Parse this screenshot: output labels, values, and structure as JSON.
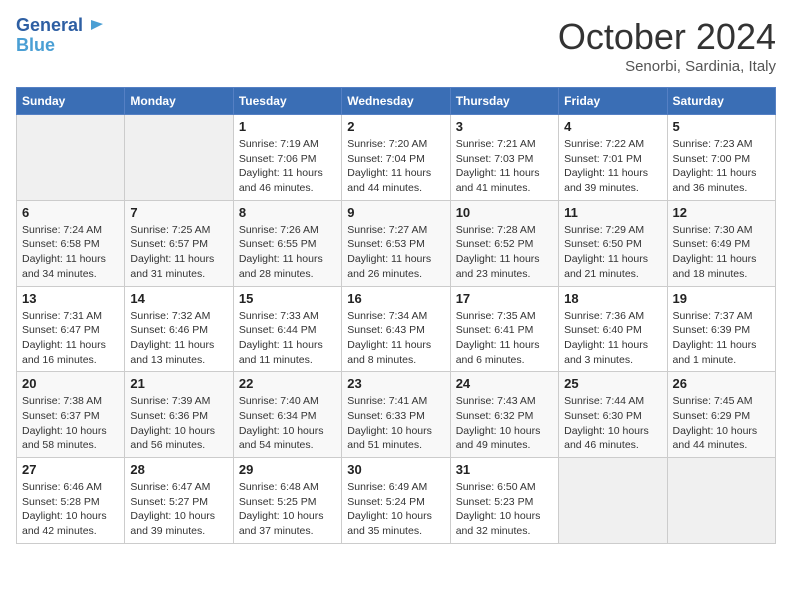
{
  "header": {
    "logo_line1": "General",
    "logo_line2": "Blue",
    "title": "October 2024",
    "location": "Senorbi, Sardinia, Italy"
  },
  "weekdays": [
    "Sunday",
    "Monday",
    "Tuesday",
    "Wednesday",
    "Thursday",
    "Friday",
    "Saturday"
  ],
  "weeks": [
    [
      {
        "day": null
      },
      {
        "day": null
      },
      {
        "day": "1",
        "sunrise": "Sunrise: 7:19 AM",
        "sunset": "Sunset: 7:06 PM",
        "daylight": "Daylight: 11 hours and 46 minutes."
      },
      {
        "day": "2",
        "sunrise": "Sunrise: 7:20 AM",
        "sunset": "Sunset: 7:04 PM",
        "daylight": "Daylight: 11 hours and 44 minutes."
      },
      {
        "day": "3",
        "sunrise": "Sunrise: 7:21 AM",
        "sunset": "Sunset: 7:03 PM",
        "daylight": "Daylight: 11 hours and 41 minutes."
      },
      {
        "day": "4",
        "sunrise": "Sunrise: 7:22 AM",
        "sunset": "Sunset: 7:01 PM",
        "daylight": "Daylight: 11 hours and 39 minutes."
      },
      {
        "day": "5",
        "sunrise": "Sunrise: 7:23 AM",
        "sunset": "Sunset: 7:00 PM",
        "daylight": "Daylight: 11 hours and 36 minutes."
      }
    ],
    [
      {
        "day": "6",
        "sunrise": "Sunrise: 7:24 AM",
        "sunset": "Sunset: 6:58 PM",
        "daylight": "Daylight: 11 hours and 34 minutes."
      },
      {
        "day": "7",
        "sunrise": "Sunrise: 7:25 AM",
        "sunset": "Sunset: 6:57 PM",
        "daylight": "Daylight: 11 hours and 31 minutes."
      },
      {
        "day": "8",
        "sunrise": "Sunrise: 7:26 AM",
        "sunset": "Sunset: 6:55 PM",
        "daylight": "Daylight: 11 hours and 28 minutes."
      },
      {
        "day": "9",
        "sunrise": "Sunrise: 7:27 AM",
        "sunset": "Sunset: 6:53 PM",
        "daylight": "Daylight: 11 hours and 26 minutes."
      },
      {
        "day": "10",
        "sunrise": "Sunrise: 7:28 AM",
        "sunset": "Sunset: 6:52 PM",
        "daylight": "Daylight: 11 hours and 23 minutes."
      },
      {
        "day": "11",
        "sunrise": "Sunrise: 7:29 AM",
        "sunset": "Sunset: 6:50 PM",
        "daylight": "Daylight: 11 hours and 21 minutes."
      },
      {
        "day": "12",
        "sunrise": "Sunrise: 7:30 AM",
        "sunset": "Sunset: 6:49 PM",
        "daylight": "Daylight: 11 hours and 18 minutes."
      }
    ],
    [
      {
        "day": "13",
        "sunrise": "Sunrise: 7:31 AM",
        "sunset": "Sunset: 6:47 PM",
        "daylight": "Daylight: 11 hours and 16 minutes."
      },
      {
        "day": "14",
        "sunrise": "Sunrise: 7:32 AM",
        "sunset": "Sunset: 6:46 PM",
        "daylight": "Daylight: 11 hours and 13 minutes."
      },
      {
        "day": "15",
        "sunrise": "Sunrise: 7:33 AM",
        "sunset": "Sunset: 6:44 PM",
        "daylight": "Daylight: 11 hours and 11 minutes."
      },
      {
        "day": "16",
        "sunrise": "Sunrise: 7:34 AM",
        "sunset": "Sunset: 6:43 PM",
        "daylight": "Daylight: 11 hours and 8 minutes."
      },
      {
        "day": "17",
        "sunrise": "Sunrise: 7:35 AM",
        "sunset": "Sunset: 6:41 PM",
        "daylight": "Daylight: 11 hours and 6 minutes."
      },
      {
        "day": "18",
        "sunrise": "Sunrise: 7:36 AM",
        "sunset": "Sunset: 6:40 PM",
        "daylight": "Daylight: 11 hours and 3 minutes."
      },
      {
        "day": "19",
        "sunrise": "Sunrise: 7:37 AM",
        "sunset": "Sunset: 6:39 PM",
        "daylight": "Daylight: 11 hours and 1 minute."
      }
    ],
    [
      {
        "day": "20",
        "sunrise": "Sunrise: 7:38 AM",
        "sunset": "Sunset: 6:37 PM",
        "daylight": "Daylight: 10 hours and 58 minutes."
      },
      {
        "day": "21",
        "sunrise": "Sunrise: 7:39 AM",
        "sunset": "Sunset: 6:36 PM",
        "daylight": "Daylight: 10 hours and 56 minutes."
      },
      {
        "day": "22",
        "sunrise": "Sunrise: 7:40 AM",
        "sunset": "Sunset: 6:34 PM",
        "daylight": "Daylight: 10 hours and 54 minutes."
      },
      {
        "day": "23",
        "sunrise": "Sunrise: 7:41 AM",
        "sunset": "Sunset: 6:33 PM",
        "daylight": "Daylight: 10 hours and 51 minutes."
      },
      {
        "day": "24",
        "sunrise": "Sunrise: 7:43 AM",
        "sunset": "Sunset: 6:32 PM",
        "daylight": "Daylight: 10 hours and 49 minutes."
      },
      {
        "day": "25",
        "sunrise": "Sunrise: 7:44 AM",
        "sunset": "Sunset: 6:30 PM",
        "daylight": "Daylight: 10 hours and 46 minutes."
      },
      {
        "day": "26",
        "sunrise": "Sunrise: 7:45 AM",
        "sunset": "Sunset: 6:29 PM",
        "daylight": "Daylight: 10 hours and 44 minutes."
      }
    ],
    [
      {
        "day": "27",
        "sunrise": "Sunrise: 6:46 AM",
        "sunset": "Sunset: 5:28 PM",
        "daylight": "Daylight: 10 hours and 42 minutes."
      },
      {
        "day": "28",
        "sunrise": "Sunrise: 6:47 AM",
        "sunset": "Sunset: 5:27 PM",
        "daylight": "Daylight: 10 hours and 39 minutes."
      },
      {
        "day": "29",
        "sunrise": "Sunrise: 6:48 AM",
        "sunset": "Sunset: 5:25 PM",
        "daylight": "Daylight: 10 hours and 37 minutes."
      },
      {
        "day": "30",
        "sunrise": "Sunrise: 6:49 AM",
        "sunset": "Sunset: 5:24 PM",
        "daylight": "Daylight: 10 hours and 35 minutes."
      },
      {
        "day": "31",
        "sunrise": "Sunrise: 6:50 AM",
        "sunset": "Sunset: 5:23 PM",
        "daylight": "Daylight: 10 hours and 32 minutes."
      },
      {
        "day": null
      },
      {
        "day": null
      }
    ]
  ]
}
